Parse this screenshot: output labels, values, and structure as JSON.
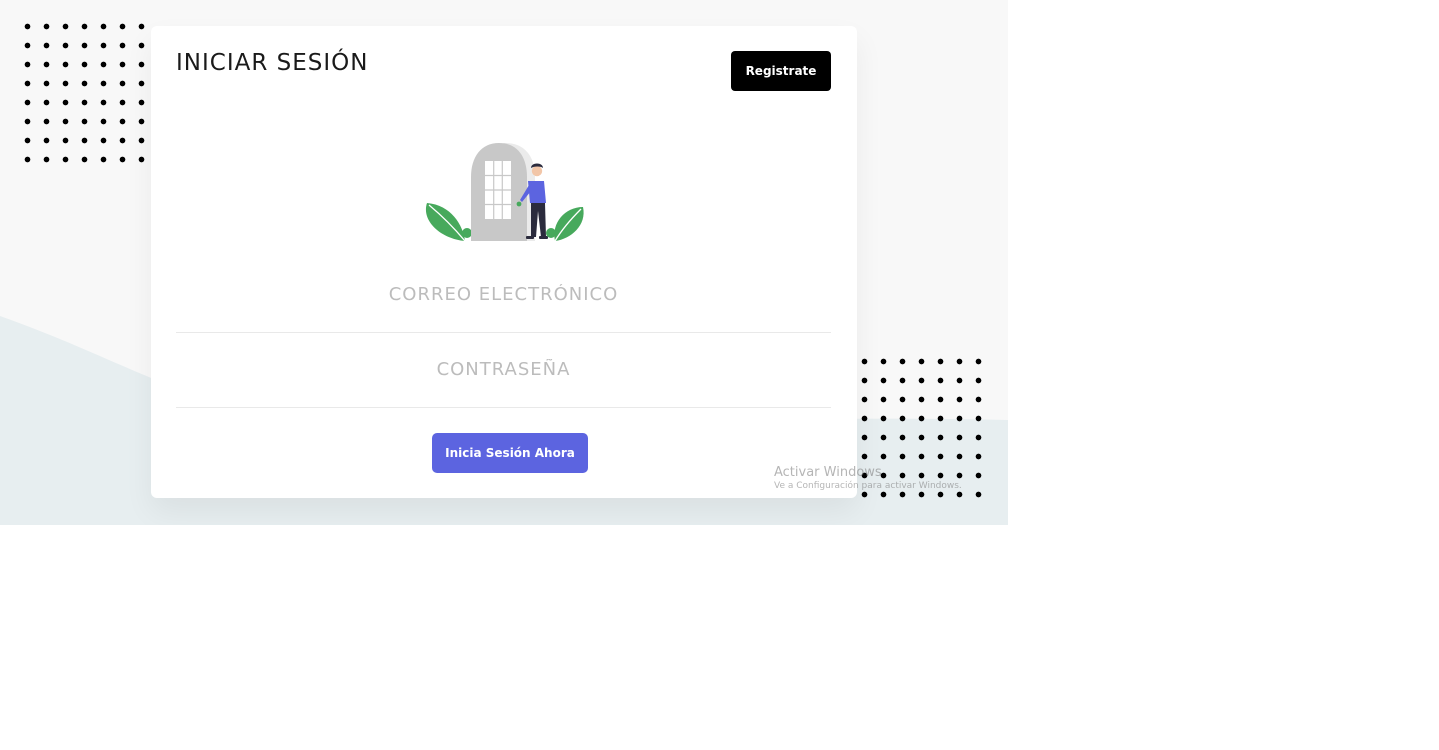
{
  "login": {
    "title": "INICIAR SESIÓN",
    "register_label": "Registrate",
    "email_placeholder": "CORREO ELECTRÓNICO",
    "email_value": "",
    "password_placeholder": "CONTRASEÑA",
    "password_value": "",
    "submit_label": "Inicia Sesión Ahora"
  },
  "illustration": {
    "icon": "person-at-door-illustration"
  },
  "watermark": {
    "line1": "Activar Windows",
    "line2": "Ve a Configuración para activar Windows."
  },
  "colors": {
    "accent": "#5c64e0",
    "register_bg": "#000000",
    "plant_green": "#47a95c",
    "door_gray": "#c8c8c8",
    "shirt_blue": "#5c64e0",
    "background": "#f8f8f8",
    "wave": "#e7eef0"
  }
}
